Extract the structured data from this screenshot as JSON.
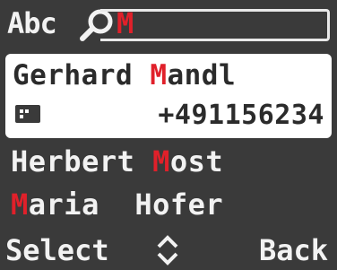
{
  "search": {
    "mode_label": "Abc",
    "query": "M",
    "icon": "search-icon"
  },
  "contacts": [
    {
      "name_pre": "Gerhard ",
      "name_match": "M",
      "name_post": "andl",
      "number": "+491156234",
      "icon": "sim-card-icon",
      "selected": true
    },
    {
      "name_pre": "Herbert ",
      "name_match": "M",
      "name_post": "ost"
    },
    {
      "name_pre": "",
      "name_match": "M",
      "name_post": "aria  Hofer"
    }
  ],
  "softkeys": {
    "left": "Select",
    "center_icon": "up-down-icon",
    "right": "Back"
  },
  "colors": {
    "background": "#3a3a3a",
    "highlight": "#e0202a",
    "selected_bg": "#ffffff",
    "text": "#f2f2f2"
  }
}
